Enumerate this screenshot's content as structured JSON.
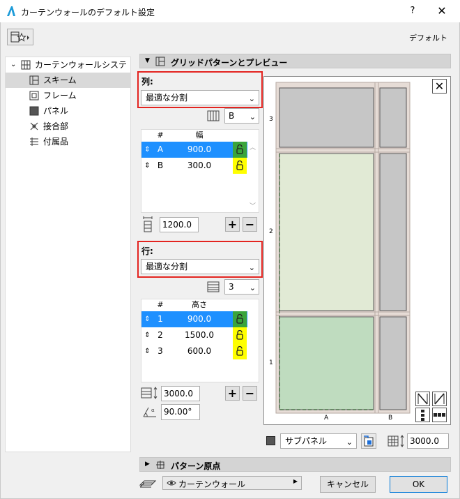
{
  "window": {
    "title": "カーテンウォールのデフォルト設定",
    "help": "?",
    "close": "✕"
  },
  "header": {
    "default_label": "デフォルト"
  },
  "tree": {
    "root": "カーテンウォールシステム",
    "items": [
      {
        "label": "スキーム",
        "selected": true
      },
      {
        "label": "フレーム"
      },
      {
        "label": "パネル"
      },
      {
        "label": "接合部"
      },
      {
        "label": "付属品"
      }
    ]
  },
  "grid_section": {
    "title": "グリッドパターンとプレビュー"
  },
  "columns": {
    "label": "列:",
    "mode": "最適な分割",
    "count_select": "B",
    "headers": {
      "num": "#",
      "value": "幅"
    },
    "rows": [
      {
        "id": "A",
        "value": "900.0",
        "lock": "green",
        "selected": true
      },
      {
        "id": "B",
        "value": "300.0",
        "lock": "yellow"
      }
    ],
    "total": "1200.0",
    "add": "+",
    "remove": "−"
  },
  "rows": {
    "label": "行:",
    "mode": "最適な分割",
    "count_select": "3",
    "headers": {
      "num": "#",
      "value": "高さ"
    },
    "rows": [
      {
        "id": "1",
        "value": "900.0",
        "lock": "green",
        "selected": true
      },
      {
        "id": "2",
        "value": "1500.0",
        "lock": "yellow"
      },
      {
        "id": "3",
        "value": "600.0",
        "lock": "yellow"
      }
    ],
    "total": "3000.0",
    "add": "+",
    "remove": "−",
    "angle": "90.00°"
  },
  "preview": {
    "row_labels": [
      "3",
      "2",
      "1"
    ],
    "col_labels": [
      "A",
      "B"
    ],
    "close": "✕",
    "colors": {
      "gray": "#c6c6c6",
      "light_green": "#e1ead5",
      "green": "#bfdcbf",
      "frame": "#e6dcd6"
    }
  },
  "panel_options": {
    "panel_select": "サブパネル",
    "height_value": "3000.0"
  },
  "origin_section": {
    "title": "パターン原点"
  },
  "footer": {
    "layer_select": "カーテンウォール",
    "cancel": "キャンセル",
    "ok": "OK"
  }
}
